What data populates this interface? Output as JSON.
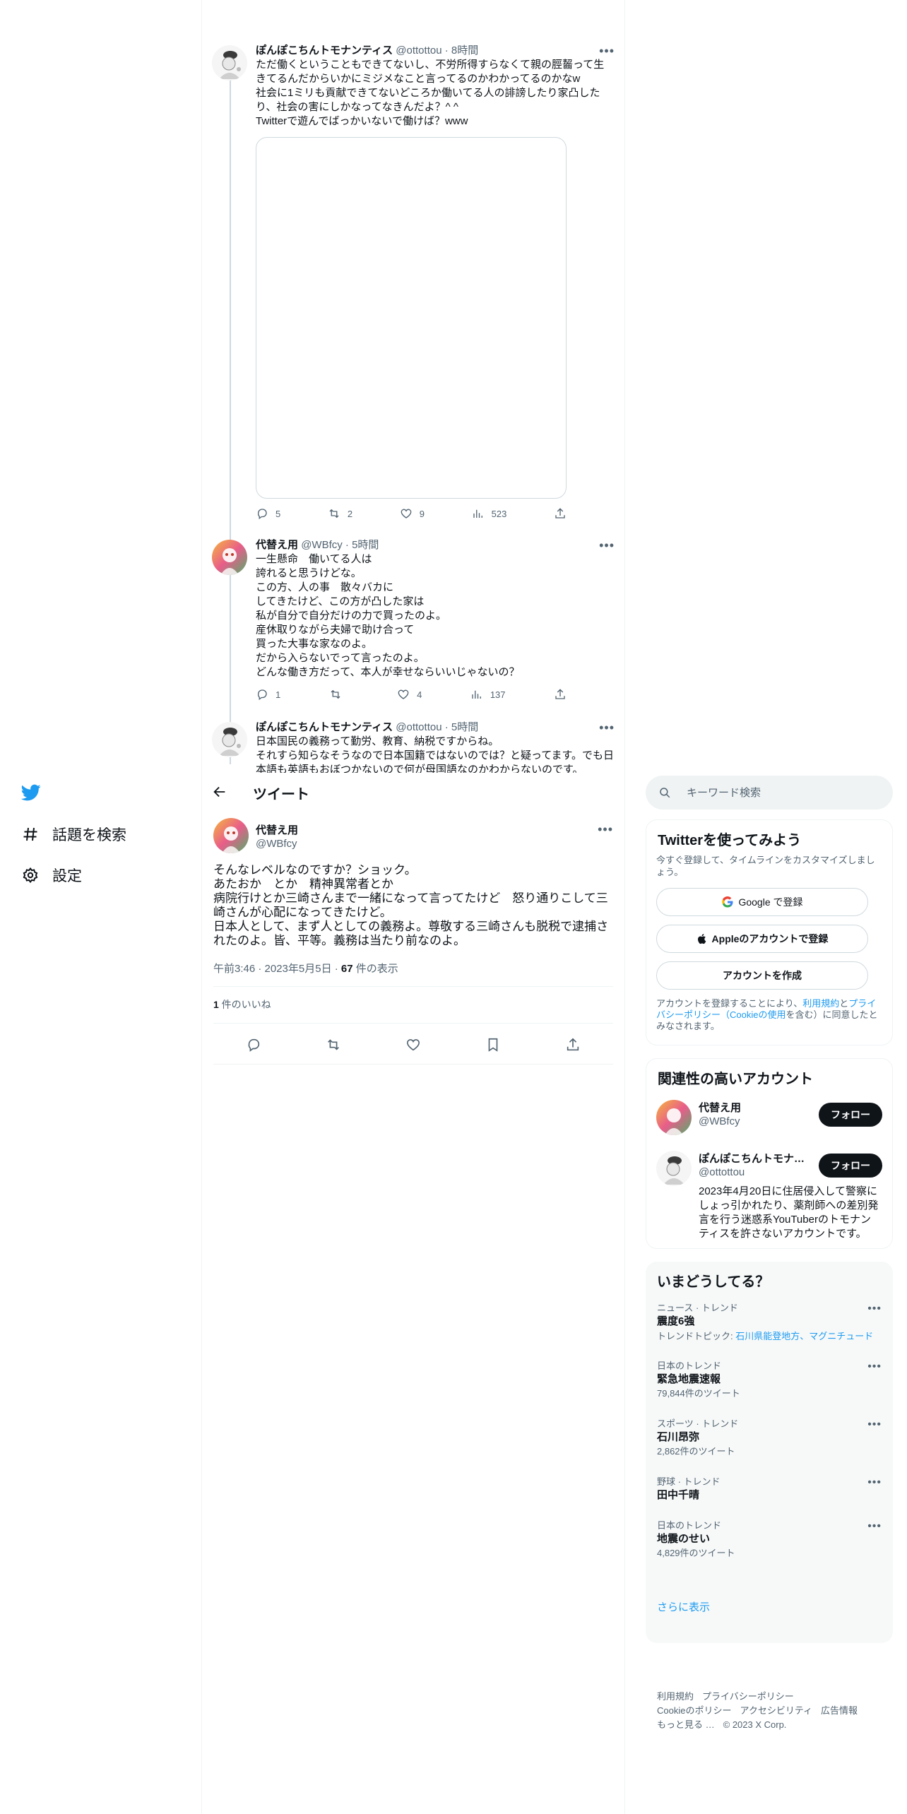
{
  "nav": {
    "explore": "話題を検索",
    "settings": "設定"
  },
  "thread": [
    {
      "name": "ぽんぽこちんトモナンティス",
      "handle": "@ottottou",
      "time": "8時間",
      "text": "ただ働くということもできてないし、不労所得すらなくて親の脛齧って生きてるんだからいかにミジメなこと言ってるのかわかってるのかなw\n社会に1ミリも貢献できてないどころか働いてる人の誹謗したり家凸したり、社会の害にしかなってなきんだよ？^ ^\nTwitterで遊んでばっかいないで働けば？www",
      "replies": "5",
      "retweets": "2",
      "likes": "9",
      "views": "523"
    },
    {
      "name": "代替え用",
      "handle": "@WBfcy",
      "time": "5時間",
      "text": "一生懸命　働いてる人は\n誇れると思うけどな。\nこの方、人の事　散々バカに\nしてきたけど、この方が凸した家は\n私が自分で自分だけの力で買ったのよ。\n産休取りながら夫婦で助け合って\n買った大事な家なのよ。\nだから入らないでって言ったのよ。\nどんな働き方だって、本人が幸せならいいじゃないの？",
      "replies": "1",
      "retweets": "",
      "likes": "4",
      "views": "137"
    },
    {
      "name": "ぽんぽこちんトモナンティス",
      "handle": "@ottottou",
      "time": "5時間",
      "text": "日本国民の義務って勤労、教育、納税ですからね。\nそれすら知らなそうなので日本国籍ではないのでは？と疑ってます。でも日本語も英語もおぼつかないので何が母国語なのかわからないのです。"
    }
  ],
  "header": {
    "title": "ツイート"
  },
  "focus": {
    "name": "代替え用",
    "handle": "@WBfcy",
    "text": "そんなレベルなのですか？ショック。\nあたおか　とか　精神異常者とか\n病院行けとか三崎さんまで一緒になって言ってたけど　怒り通りこして三崎さんが心配になってきたけど。\n日本人として、まず人としての義務よ。尊敬する三崎さんも脱税で逮捕されたのよ。皆、平等。義務は当たり前なのよ。",
    "time": "午前3:46 · 2023年5月5日 · ",
    "views_count": "67",
    "views_label": " 件の表示",
    "likes_count": "1",
    "likes_label": " 件のいいね"
  },
  "search": {
    "placeholder": "キーワード検索"
  },
  "try": {
    "title": "Twitterを使ってみよう",
    "subtitle": "今すぐ登録して、タイムラインをカスタマイズしましょう。",
    "google": "Google で登録",
    "apple": "Appleのアカウントで登録",
    "create": "アカウントを作成",
    "legal_pre": "アカウントを登録することにより、",
    "legal_terms": "利用規約",
    "legal_and": "と",
    "legal_privacy": "プライバシーポリシー（Cookieの使用",
    "legal_post": "を含む）に同意したとみなされます。"
  },
  "related": {
    "title": "関連性の高いアカウント",
    "follow": "フォロー",
    "accounts": [
      {
        "name": "代替え用",
        "handle": "@WBfcy",
        "bio": ""
      },
      {
        "name": "ぽんぽこちんトモナ…",
        "handle": "@ottottou",
        "bio": "2023年4月20日に住居侵入して警察にしょっ引かれたり、薬剤師への差別発言を行う迷惑系YouTuberのトモナンティスを許さないアカウントです。"
      }
    ]
  },
  "trends": {
    "title": "いまどうしてる？",
    "items": [
      {
        "category": "ニュース · トレンド",
        "name": "震度6強",
        "topics_label": "トレンドトピック: ",
        "topics": "石川県能登地方、マグニチュード",
        "count": ""
      },
      {
        "category": "日本のトレンド",
        "name": "緊急地震速報",
        "count": "79,844件のツイート"
      },
      {
        "category": "スポーツ · トレンド",
        "name": "石川昂弥",
        "count": "2,862件のツイート"
      },
      {
        "category": "野球 · トレンド",
        "name": "田中千晴",
        "count": ""
      },
      {
        "category": "日本のトレンド",
        "name": "地震のせい",
        "count": "4,829件のツイート"
      }
    ],
    "show_more": "さらに表示"
  },
  "footer": {
    "terms": "利用規約",
    "privacy": "プライバシーポリシー",
    "cookie": "Cookieのポリシー",
    "accessibility": "アクセシビリティ",
    "ads": "広告情報",
    "more": "もっと見る …",
    "copyright": "© 2023 X Corp."
  },
  "colors": {
    "accent": "#1d9bf0",
    "text": "#0f1419",
    "secondary": "#536471",
    "border": "#eff3f4"
  }
}
